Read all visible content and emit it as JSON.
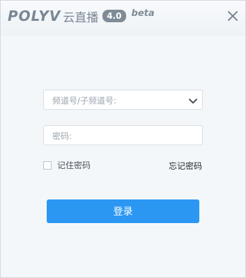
{
  "header": {
    "brand": "POLYV",
    "product": "云直播",
    "version": "4.0",
    "tag": "beta"
  },
  "form": {
    "channel_placeholder": "频道号/子频道号:",
    "password_placeholder": "密码:",
    "remember_label": "记住密码",
    "forgot_label": "忘记密码",
    "remember_checked": false
  },
  "actions": {
    "login_label": "登录"
  },
  "colors": {
    "accent": "#2b97f3",
    "brand_gray": "#7a8794",
    "window_bg": "#f4f7fa"
  },
  "icons": {
    "close": "close-icon",
    "dropdown": "chevron-down-icon"
  }
}
